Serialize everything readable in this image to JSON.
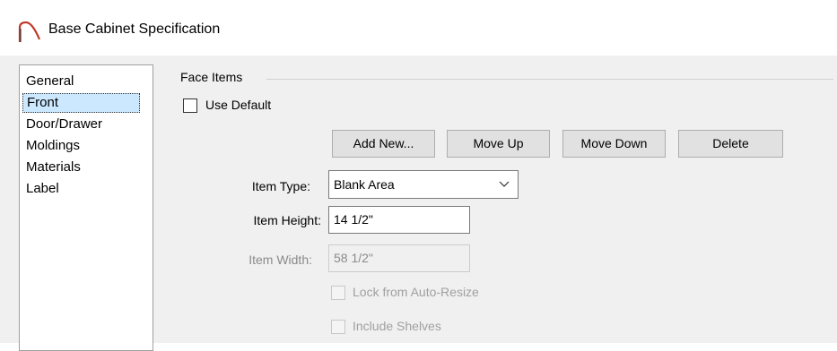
{
  "window": {
    "title": "Base Cabinet Specification",
    "icon": "arch-icon"
  },
  "sidebar": {
    "items": [
      {
        "label": "General",
        "selected": false
      },
      {
        "label": "Front",
        "selected": true
      },
      {
        "label": "Door/Drawer",
        "selected": false
      },
      {
        "label": "Moldings",
        "selected": false
      },
      {
        "label": "Materials",
        "selected": false
      },
      {
        "label": "Label",
        "selected": false
      }
    ]
  },
  "face_items": {
    "group_label": "Face Items",
    "use_default": {
      "label": "Use Default",
      "checked": false
    },
    "buttons": {
      "add_new": "Add New...",
      "move_up": "Move Up",
      "move_down": "Move Down",
      "delete": "Delete"
    },
    "item_type": {
      "label": "Item Type:",
      "value": "Blank Area"
    },
    "item_height": {
      "label": "Item Height:",
      "value": "14 1/2\""
    },
    "item_width": {
      "label": "Item Width:",
      "value": "58 1/2\"",
      "disabled": true
    },
    "lock_auto_resize": {
      "label": "Lock from Auto-Resize",
      "checked": false,
      "disabled": true
    },
    "include_shelves": {
      "label": "Include Shelves",
      "checked": false,
      "disabled": true
    }
  }
}
